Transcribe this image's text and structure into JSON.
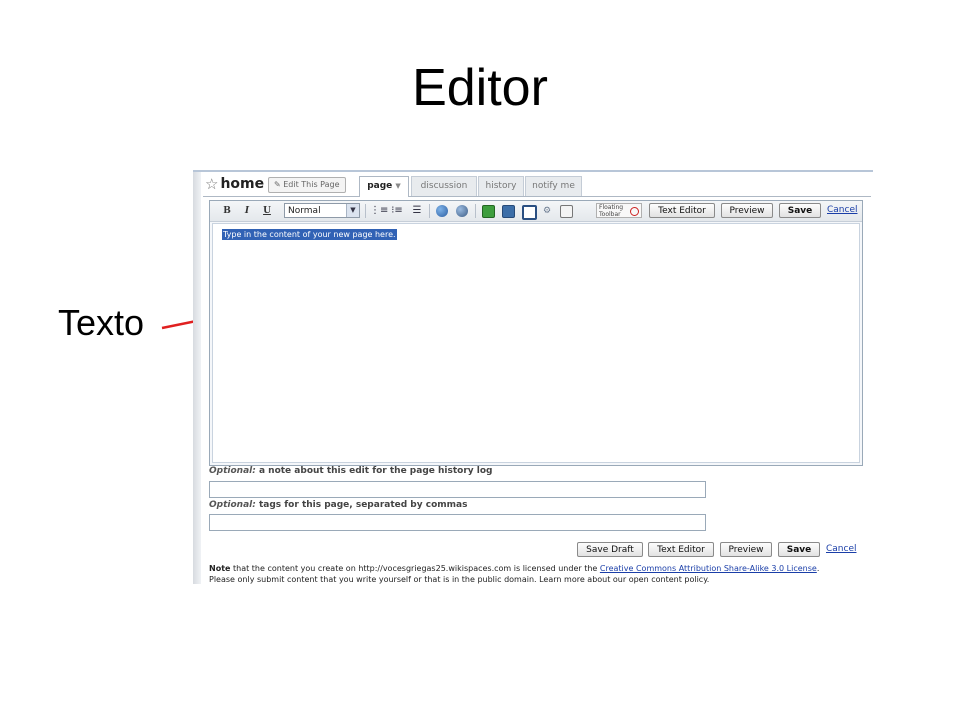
{
  "slide": {
    "title": "Editor",
    "callout_label": "Texto",
    "arrow_color": "#e02020"
  },
  "wiki": {
    "page_name": "home",
    "edit_this_page": "Edit This Page",
    "tabs": [
      {
        "label": "page",
        "active": true,
        "has_dropdown": true
      },
      {
        "label": "discussion",
        "active": false
      },
      {
        "label": "history",
        "active": false
      },
      {
        "label": "notify me",
        "active": false
      }
    ]
  },
  "toolbar": {
    "bold": "B",
    "italic": "I",
    "underline": "U",
    "format_value": "Normal",
    "floating_toolbar": "Floating Toolbar",
    "text_editor": "Text Editor",
    "preview": "Preview",
    "save": "Save",
    "cancel": "Cancel"
  },
  "editor": {
    "selected_text": "Type in the content of your new page here."
  },
  "fields": {
    "note_optional": "Optional:",
    "note_label": " a note about this edit for the page history log",
    "note_value": "",
    "tags_optional": "Optional:",
    "tags_label": " tags for this page, separated by commas",
    "tags_value": ""
  },
  "bottom_buttons": {
    "save_draft": "Save Draft",
    "text_editor": "Text Editor",
    "preview": "Preview",
    "save": "Save",
    "cancel": "Cancel"
  },
  "license": {
    "note_bold": "Note",
    "note_text": " that the content you create on http://vocesgriegas25.wikispaces.com is licensed under the ",
    "license_link": "Creative Commons Attribution Share-Alike 3.0 License",
    "note_end": ".",
    "line2": "Please only submit content that you write yourself or that is in the public domain. Learn more about our open content policy."
  },
  "colors": {
    "selection": "#3162b5",
    "link": "#1a3ea8",
    "frame_border": "#9aa9b8"
  }
}
